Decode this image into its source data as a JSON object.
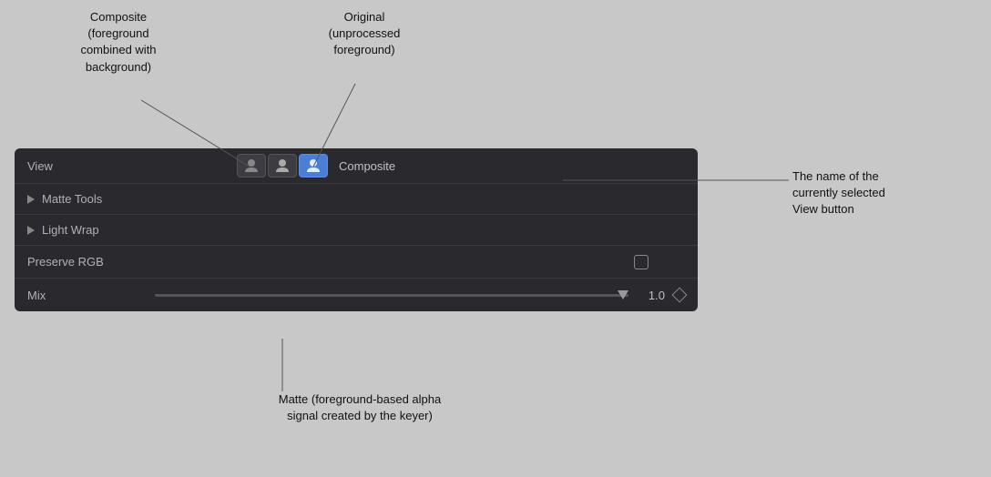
{
  "annotations": {
    "composite_label": "Composite\n(foreground\ncombined with\nbackground)",
    "original_label": "Original\n(unprocessed\nforeground)",
    "matte_label": "Matte (foreground-based alpha\nsignal created by the keyer)",
    "view_name_label": "The name of the\ncurrently selected\nView button"
  },
  "panel": {
    "view_label": "View",
    "view_buttons": [
      {
        "id": "matte",
        "active": false,
        "title": "Matte"
      },
      {
        "id": "original",
        "active": false,
        "title": "Original"
      },
      {
        "id": "composite",
        "active": true,
        "title": "Composite"
      }
    ],
    "composite_name": "Composite",
    "matte_tools_label": "Matte Tools",
    "light_wrap_label": "Light Wrap",
    "preserve_rgb_label": "Preserve RGB",
    "mix_label": "Mix",
    "mix_value": "1.0"
  }
}
